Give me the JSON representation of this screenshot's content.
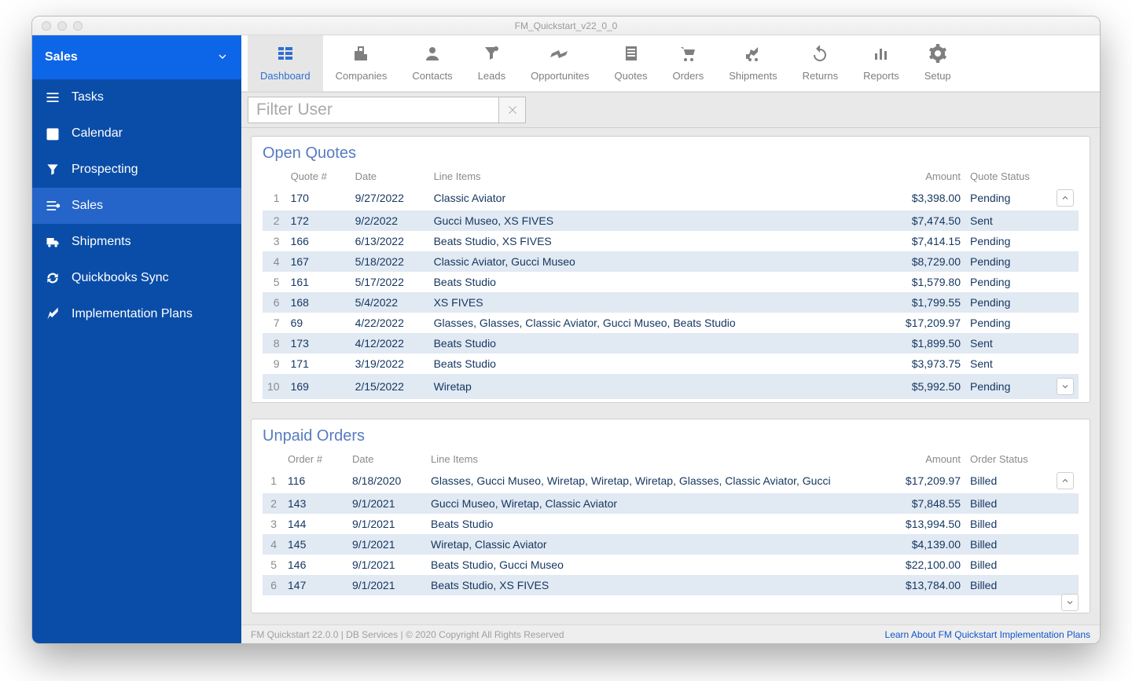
{
  "window_title": "FM_Quickstart_v22_0_0",
  "sidebar": {
    "header": "Sales",
    "items": [
      {
        "label": "Tasks"
      },
      {
        "label": "Calendar"
      },
      {
        "label": "Prospecting"
      },
      {
        "label": "Sales",
        "active": true
      },
      {
        "label": "Shipments"
      },
      {
        "label": "Quickbooks Sync"
      },
      {
        "label": "Implementation Plans"
      }
    ]
  },
  "toolbar": [
    {
      "label": "Dashboard",
      "active": true
    },
    {
      "label": "Companies"
    },
    {
      "label": "Contacts"
    },
    {
      "label": "Leads"
    },
    {
      "label": "Opportunites"
    },
    {
      "label": "Quotes"
    },
    {
      "label": "Orders"
    },
    {
      "label": "Shipments"
    },
    {
      "label": "Returns"
    },
    {
      "label": "Reports"
    },
    {
      "label": "Setup"
    }
  ],
  "filter": {
    "placeholder": "Filter User"
  },
  "open_quotes": {
    "title": "Open Quotes",
    "columns": [
      "Quote #",
      "Date",
      "Line Items",
      "Amount",
      "Quote Status"
    ],
    "rows": [
      {
        "n": "1",
        "id": "170",
        "date": "9/27/2022",
        "items": "Classic Aviator",
        "amount": "$3,398.00",
        "status": "Pending"
      },
      {
        "n": "2",
        "id": "172",
        "date": "9/2/2022",
        "items": "Gucci Museo, XS FIVES",
        "amount": "$7,474.50",
        "status": "Sent"
      },
      {
        "n": "3",
        "id": "166",
        "date": "6/13/2022",
        "items": "Beats Studio, XS FIVES",
        "amount": "$7,414.15",
        "status": "Pending"
      },
      {
        "n": "4",
        "id": "167",
        "date": "5/18/2022",
        "items": "Classic Aviator, Gucci Museo",
        "amount": "$8,729.00",
        "status": "Pending"
      },
      {
        "n": "5",
        "id": "161",
        "date": "5/17/2022",
        "items": "Beats Studio",
        "amount": "$1,579.80",
        "status": "Pending"
      },
      {
        "n": "6",
        "id": "168",
        "date": "5/4/2022",
        "items": "XS FIVES",
        "amount": "$1,799.55",
        "status": "Pending"
      },
      {
        "n": "7",
        "id": "69",
        "date": "4/22/2022",
        "items": "Glasses, Glasses, Classic Aviator, Gucci Museo, Beats Studio",
        "amount": "$17,209.97",
        "status": "Pending"
      },
      {
        "n": "8",
        "id": "173",
        "date": "4/12/2022",
        "items": "Beats Studio",
        "amount": "$1,899.50",
        "status": "Sent"
      },
      {
        "n": "9",
        "id": "171",
        "date": "3/19/2022",
        "items": "Beats Studio",
        "amount": "$3,973.75",
        "status": "Sent"
      },
      {
        "n": "10",
        "id": "169",
        "date": "2/15/2022",
        "items": "Wiretap",
        "amount": "$5,992.50",
        "status": "Pending"
      }
    ]
  },
  "unpaid_orders": {
    "title": "Unpaid Orders",
    "columns": [
      "Order #",
      "Date",
      "Line Items",
      "Amount",
      "Order Status"
    ],
    "rows": [
      {
        "n": "1",
        "id": "116",
        "date": "8/18/2020",
        "items": "Glasses, Gucci Museo, Wiretap, Wiretap, Wiretap, Glasses, Classic Aviator, Gucci",
        "amount": "$17,209.97",
        "status": "Billed"
      },
      {
        "n": "2",
        "id": "143",
        "date": "9/1/2021",
        "items": "Gucci Museo, Wiretap, Classic Aviator",
        "amount": "$7,848.55",
        "status": "Billed"
      },
      {
        "n": "3",
        "id": "144",
        "date": "9/1/2021",
        "items": "Beats Studio",
        "amount": "$13,994.50",
        "status": "Billed"
      },
      {
        "n": "4",
        "id": "145",
        "date": "9/1/2021",
        "items": "Wiretap, Classic Aviator",
        "amount": "$4,139.00",
        "status": "Billed"
      },
      {
        "n": "5",
        "id": "146",
        "date": "9/1/2021",
        "items": "Beats Studio, Gucci Museo",
        "amount": "$22,100.00",
        "status": "Billed"
      },
      {
        "n": "6",
        "id": "147",
        "date": "9/1/2021",
        "items": "Beats Studio, XS FIVES",
        "amount": "$13,784.00",
        "status": "Billed"
      }
    ]
  },
  "footer": {
    "left": "FM Quickstart 22.0.0  | DB Services | © 2020 Copyright All Rights Reserved",
    "right": "Learn About FM Quickstart Implementation Plans"
  }
}
